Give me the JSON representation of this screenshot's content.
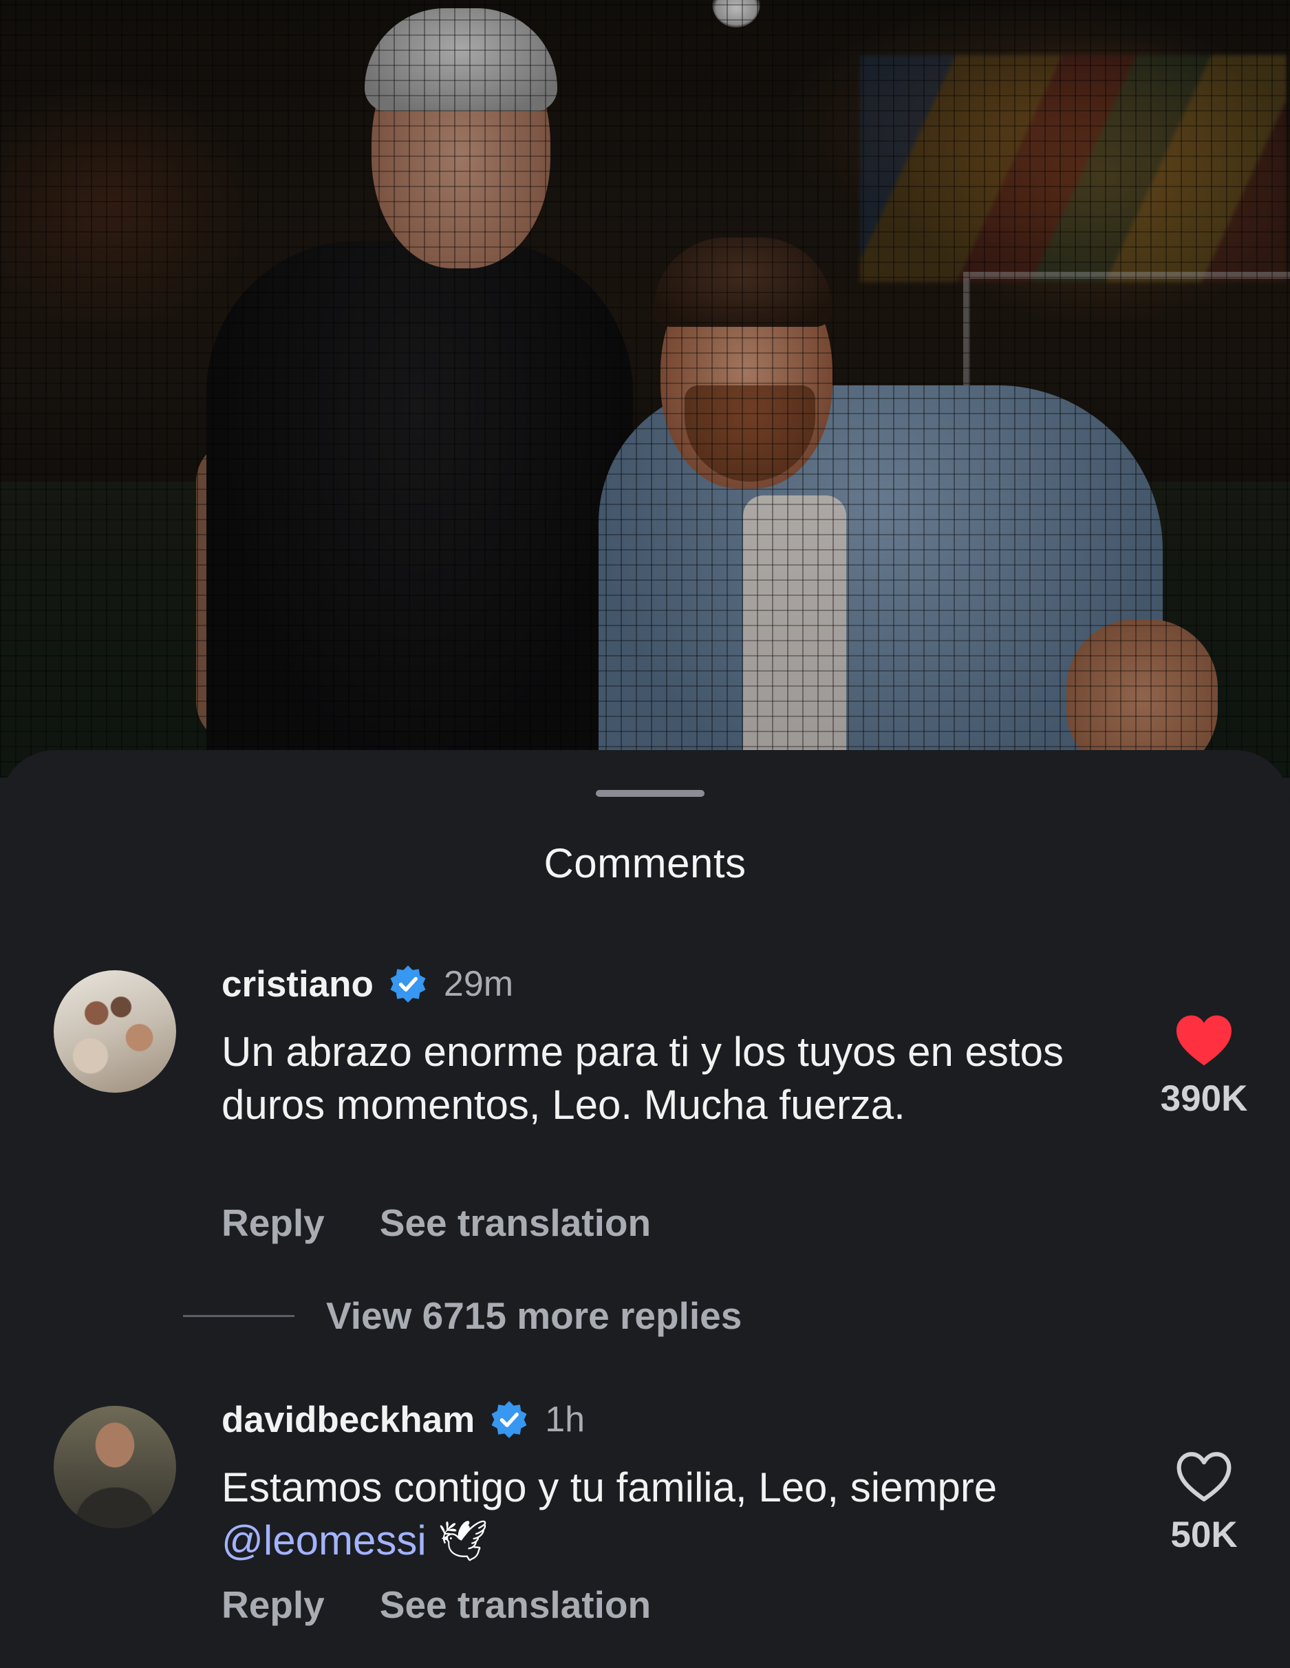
{
  "sheet": {
    "title": "Comments"
  },
  "comments": [
    {
      "username": "cristiano",
      "verified": true,
      "time": "29m",
      "text": "Un abrazo enorme para ti y los tuyos en estos duros momentos, Leo. Mucha fuerza.",
      "liked": true,
      "like_count": "390K",
      "reply_label": "Reply",
      "translate_label": "See translation",
      "view_replies_label": "View 6715 more replies"
    },
    {
      "username": "davidbeckham",
      "verified": true,
      "time": "1h",
      "text_before": "Estamos contigo y tu familia, Leo, siempre ",
      "mention": "@leomessi",
      "emoji": "🕊",
      "liked": false,
      "like_count": "50K",
      "reply_label": "Reply",
      "translate_label": "See translation"
    }
  ],
  "icons": {
    "verified": "verified-badge-icon",
    "like_filled": "heart-filled-icon",
    "like_outline": "heart-outline-icon"
  },
  "colors": {
    "background": "#1b1d21",
    "verified": "#3897f0",
    "heart": "#ff3040",
    "mention": "#a3b3ff",
    "muted": "#a9acb2"
  }
}
